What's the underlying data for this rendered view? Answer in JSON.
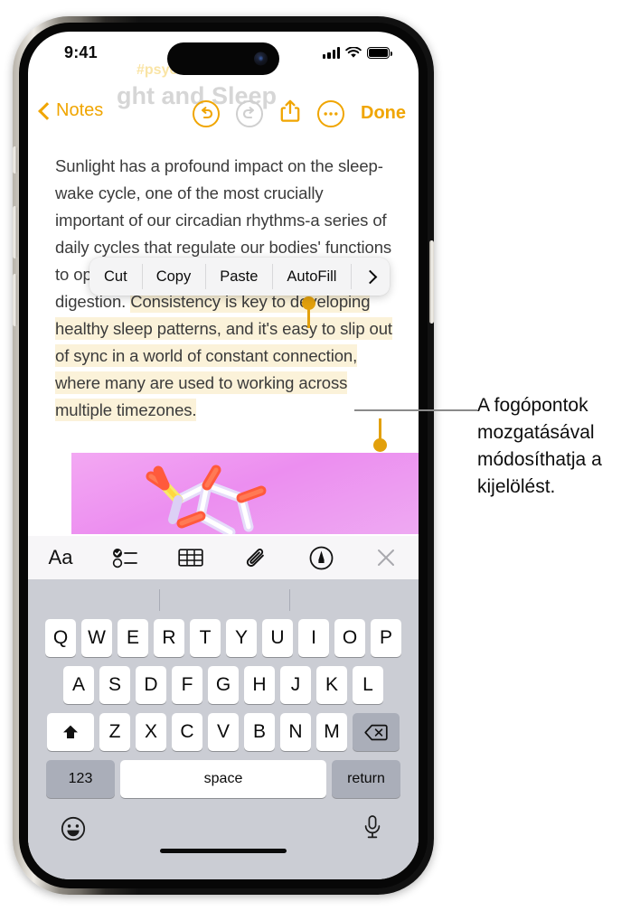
{
  "status_bar": {
    "time": "9:41",
    "signal_icon": "cellular-bars-icon",
    "wifi_icon": "wifi-icon",
    "battery_icon": "battery-full-icon"
  },
  "background_note": {
    "hashtag": "#psyc",
    "scrolled_title": "ght and Sleep"
  },
  "nav_bar": {
    "back_label": "Notes",
    "back_icon": "chevron-left-icon",
    "undo_icon": "undo-arrow-icon",
    "redo_icon": "redo-arrow-icon",
    "share_icon": "share-square-arrow-up-icon",
    "more_icon": "ellipsis-circle-icon",
    "done_label": "Done"
  },
  "note": {
    "text_before": "Sunlight has a profound impact on the sleep-wake cycle, one of the most crucially important of our circadian rhythms-a series of daily cycles that regulate our bodies' functions to optimize everything from wakefulness to digestion. ",
    "text_selected": "Consistency is key to developing healthy sleep patterns, and it's easy to slip out of sync in a world of constant connection, where many are used to working across multiple timezones.",
    "selection_highlight_color": "#fbf2d9",
    "selection_handle_color": "#e2a00c",
    "attachment_name": "molecule-image"
  },
  "edit_menu": {
    "items": [
      {
        "label": "Cut",
        "name": "cut"
      },
      {
        "label": "Copy",
        "name": "copy"
      },
      {
        "label": "Paste",
        "name": "paste"
      },
      {
        "label": "AutoFill",
        "name": "autofill"
      }
    ],
    "more_icon": "chevron-right-icon"
  },
  "format_toolbar": {
    "items": [
      {
        "label": "Aa",
        "name": "text-format-icon"
      },
      {
        "label": "",
        "name": "checklist-icon"
      },
      {
        "label": "",
        "name": "table-icon"
      },
      {
        "label": "",
        "name": "paperclip-attach-icon"
      },
      {
        "label": "",
        "name": "markup-pen-circle-icon"
      },
      {
        "label": "",
        "name": "close-x-icon"
      }
    ]
  },
  "keyboard": {
    "row1": [
      "Q",
      "W",
      "E",
      "R",
      "T",
      "Y",
      "U",
      "I",
      "O",
      "P"
    ],
    "row2": [
      "A",
      "S",
      "D",
      "F",
      "G",
      "H",
      "J",
      "K",
      "L"
    ],
    "row3": [
      "Z",
      "X",
      "C",
      "V",
      "B",
      "N",
      "M"
    ],
    "shift_icon": "shift-arrow-up-icon",
    "delete_icon": "delete-backspace-icon",
    "numbers_label": "123",
    "space_label": "space",
    "return_label": "return",
    "emoji_icon": "emoji-smiley-icon",
    "dictation_icon": "microphone-icon"
  },
  "callout": {
    "text": "A fogópontok mozgatásával módosíthatja a kijelölést."
  },
  "colors": {
    "accent": "#f0a500",
    "handle": "#e2a00c",
    "highlight": "#fbf2d9",
    "keyboard_bg": "#cbcdd4"
  }
}
